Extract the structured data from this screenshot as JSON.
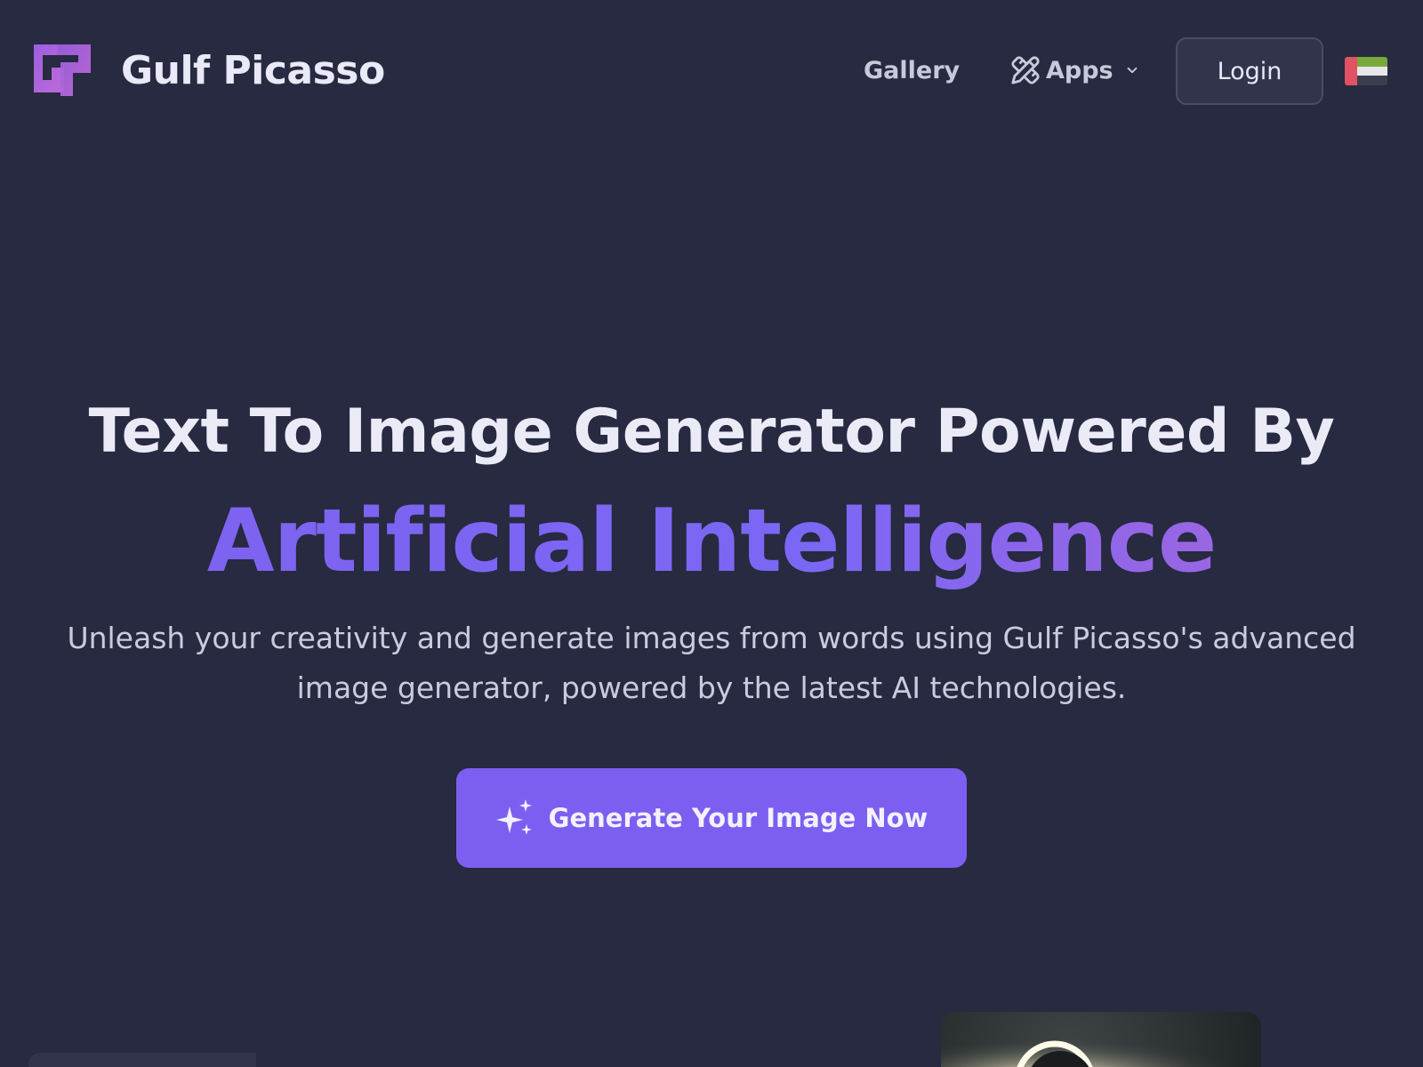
{
  "header": {
    "brand": "Gulf Picasso",
    "nav": {
      "gallery": "Gallery",
      "apps": "Apps"
    },
    "login": "Login",
    "language_flag": "uae-flag-icon"
  },
  "hero": {
    "title_line1": "Text To Image Generator Powered By",
    "title_line2": "Artificial Intelligence",
    "subtitle": "Unleash your creativity and generate images from words using Gulf Picasso's advanced image generator, powered by the latest AI technologies.",
    "cta": "Generate Your Image Now"
  },
  "colors": {
    "background": "#272a40",
    "accent": "#7c5ff0",
    "logo": "#b266dd"
  }
}
